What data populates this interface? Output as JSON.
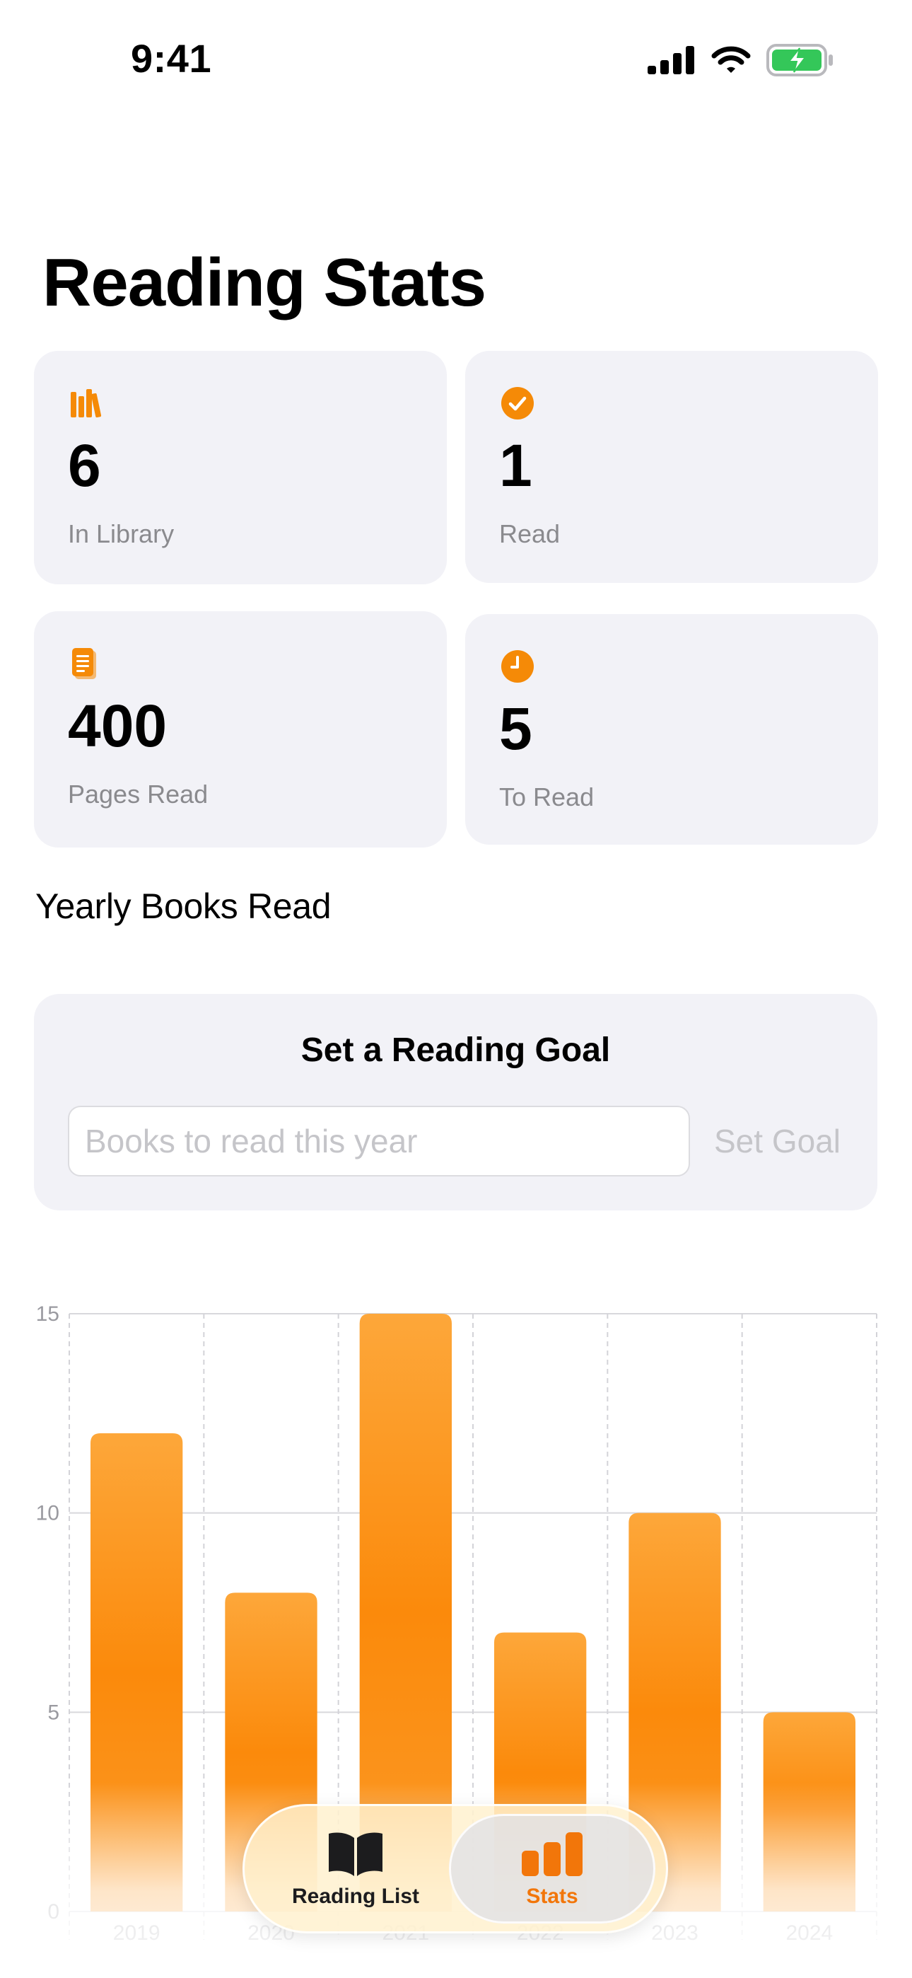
{
  "status_bar": {
    "time": "9:41"
  },
  "page": {
    "title": "Reading Stats"
  },
  "stats": [
    {
      "value": "6",
      "label": "In Library",
      "icon": "books-icon"
    },
    {
      "value": "1",
      "label": "Read",
      "icon": "checkmark-circle-icon"
    },
    {
      "value": "400",
      "label": "Pages Read",
      "icon": "document-icon"
    },
    {
      "value": "5",
      "label": "To Read",
      "icon": "clock-icon"
    }
  ],
  "section": {
    "title": "Yearly Books Read"
  },
  "goal": {
    "title": "Set a Reading Goal",
    "input_value": "",
    "input_placeholder": "Books to read this year",
    "button_label": "Set Goal"
  },
  "colors": {
    "accent": "#F58A07",
    "card_background": "#F2F2F7"
  },
  "chart_data": {
    "type": "bar",
    "title": "",
    "xlabel": "",
    "ylabel": "",
    "categories": [
      "2019",
      "2020",
      "2021",
      "2022",
      "2023",
      "2024"
    ],
    "values": [
      12,
      8,
      15,
      7,
      10,
      5
    ],
    "ylim": [
      0,
      15
    ],
    "yticks": [
      0,
      5,
      10,
      15
    ],
    "grid": true,
    "legend": "none"
  },
  "tab_bar": {
    "items": [
      {
        "label": "Reading List",
        "icon": "book-open-icon",
        "selected": false
      },
      {
        "label": "Stats",
        "icon": "bar-chart-icon",
        "selected": true
      }
    ]
  }
}
